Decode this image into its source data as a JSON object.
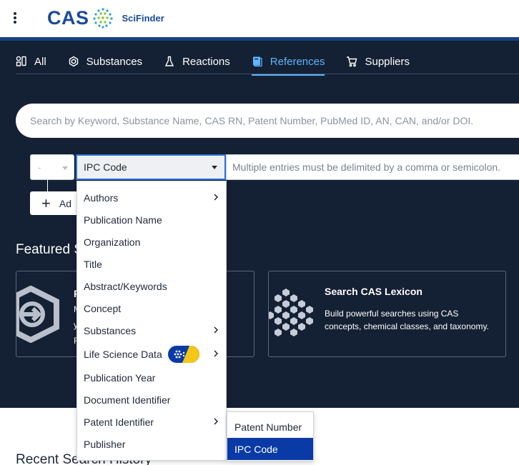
{
  "header": {
    "brand": "CAS",
    "product": "SciFinder"
  },
  "tabs": [
    {
      "label": "All",
      "icon": "all-icon",
      "active": false
    },
    {
      "label": "Substances",
      "icon": "substance-icon",
      "active": false
    },
    {
      "label": "Reactions",
      "icon": "flask-icon",
      "active": false
    },
    {
      "label": "References",
      "icon": "book-icon",
      "active": true
    },
    {
      "label": "Suppliers",
      "icon": "cart-icon",
      "active": false
    }
  ],
  "search": {
    "placeholder": "Search by Keyword, Substance Name, CAS RN, Patent Number, PubMed ID, AN, CAN, and/or DOI."
  },
  "advanced": {
    "operator_value": "-",
    "field_value": "IPC Code",
    "value_placeholder": "Multiple entries must be delimited by a comma or semicolon.",
    "add_label": "Ad"
  },
  "featured": {
    "title": "Featured S",
    "card1_letters": [
      "F",
      "M",
      "y",
      "F"
    ],
    "card2": {
      "title": "Search CAS Lexicon",
      "description": "Build powerful searches using CAS concepts, chemical classes, and taxonomy."
    }
  },
  "menu": {
    "items": [
      {
        "label": "Authors",
        "submenu": true
      },
      {
        "label": "Publication Name",
        "submenu": false
      },
      {
        "label": "Organization",
        "submenu": false
      },
      {
        "label": "Title",
        "submenu": false
      },
      {
        "label": "Abstract/Keywords",
        "submenu": false
      },
      {
        "label": "Concept",
        "submenu": false
      },
      {
        "label": "Substances",
        "submenu": true
      },
      {
        "label": "Life Science Data",
        "submenu": true,
        "badge": "life-science-badge-icon"
      },
      {
        "label": "Publication Year",
        "submenu": false
      },
      {
        "label": "Document Identifier",
        "submenu": false
      },
      {
        "label": "Patent Identifier",
        "submenu": true
      },
      {
        "label": "Publisher",
        "submenu": false
      }
    ]
  },
  "submenu": {
    "items": [
      {
        "label": "Patent Number",
        "selected": false
      },
      {
        "label": "IPC Code",
        "selected": true
      }
    ]
  },
  "recent": {
    "title": "Recent Search History"
  },
  "colors": {
    "hero_bg": "#142033",
    "accent": "#5fb5ff",
    "brand_blue": "#1b4b9a",
    "selected_bg": "#0a3aa6"
  }
}
